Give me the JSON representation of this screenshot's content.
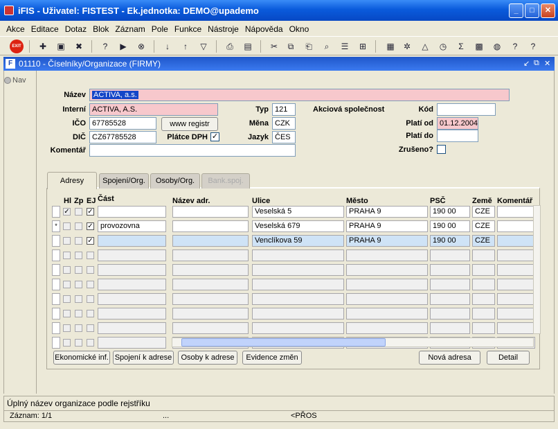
{
  "window": {
    "title": "iFIS - Uživatel: FISTEST - Ek.jednotka: DEMO@upademo"
  },
  "menu": [
    "Akce",
    "Editace",
    "Dotaz",
    "Blok",
    "Záznam",
    "Pole",
    "Funkce",
    "Nástroje",
    "Nápověda",
    "Okno"
  ],
  "toolbar": {
    "exit_label": "EXIT"
  },
  "form": {
    "title": "01110 - Číselníky/Organizace (FIRMY)",
    "nav_label": "Nav"
  },
  "fields": {
    "nazev_label": "Název",
    "nazev": "ACTIVA, a.s.",
    "interni_label": "Interní",
    "interni": "ACTIVA, A.S.",
    "ico_label": "IČO",
    "ico": "67785528",
    "dic_label": "DIČ",
    "dic": "CZ67785528",
    "komentar_label": "Komentář",
    "komentar": "",
    "typ_label": "Typ",
    "typ": "121",
    "typ_desc": "Akciová společnost",
    "mena_label": "Měna",
    "mena": "CZK",
    "jazyk_label": "Jazyk",
    "jazyk": "ČES",
    "platce_dph_label": "Plátce DPH",
    "platce_dph": "✓",
    "kod_label": "Kód",
    "kod": "",
    "plati_od_label": "Platí od",
    "plati_od": "01.12.2004",
    "plati_do_label": "Platí do",
    "plati_do": "",
    "zruseno_label": "Zrušeno?",
    "www_button": "www registr"
  },
  "tabs": [
    "Adresy",
    "Spojení/Org.",
    "Osoby/Org.",
    "Bank.spoj."
  ],
  "table": {
    "headers": [
      "Hl",
      "Zp",
      "EJ",
      "Část",
      "Název adr.",
      "Ulice",
      "Město",
      "PSČ",
      "Země",
      "Komentář"
    ],
    "rows": [
      {
        "ind": "",
        "hl": "✓",
        "zp": "",
        "ej": "✓",
        "cast": "",
        "nazev": "",
        "ulice": "Veselská 5",
        "mesto": "PRAHA 9",
        "psc": "190 00",
        "zeme": "CZE",
        "kom": ""
      },
      {
        "ind": "*",
        "hl": "",
        "zp": "",
        "ej": "✓",
        "cast": "provozovna",
        "nazev": "",
        "ulice": "Veselská 679",
        "mesto": "PRAHA 9",
        "psc": "190 00",
        "zeme": "CZE",
        "kom": ""
      },
      {
        "ind": "",
        "hl": "",
        "zp": "",
        "ej": "✓",
        "cast": "",
        "nazev": "",
        "ulice": "Venclíkova 59",
        "mesto": "PRAHA 9",
        "psc": "190 00",
        "zeme": "CZE",
        "kom": ""
      }
    ]
  },
  "buttons": {
    "ekonomicke": "Ekonomické inf.",
    "spojeni": "Spojení k adrese",
    "osoby": "Osoby k adrese",
    "evidence": "Evidence změn",
    "nova": "Nová adresa",
    "detail": "Detail"
  },
  "status": {
    "hint": "Úplný název organizace podle rejstříku",
    "record": "Záznam: 1/1",
    "dots": "...",
    "mode": "<PŘOS"
  }
}
